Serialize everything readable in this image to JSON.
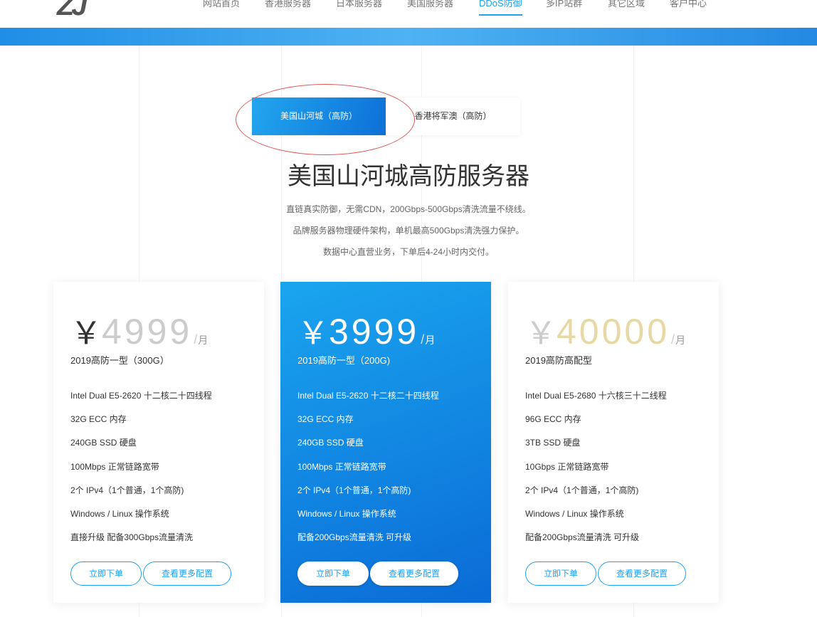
{
  "nav": {
    "logo": "ZJ",
    "items": [
      "网站首页",
      "香港服务器",
      "日本服务器",
      "美国服务器",
      "DDoS防御",
      "多IP站群",
      "其它区域",
      "客户中心"
    ],
    "active_index": 4
  },
  "tabs": [
    "美国山河城（高防）",
    "香港将军澳（高防）"
  ],
  "active_tab": 0,
  "heading": "美国山河城高防服务器",
  "description": [
    "直链真实防御，无需CDN，200Gbps-500Gbps清洗流量不绕线。",
    "品牌服务器物理硬件架构，单机最高500Gbps清洗强力保护。",
    "数据中心直营业务，下单后4-24小时内交付。"
  ],
  "plans": [
    {
      "currency": "￥",
      "price": "4999",
      "unit": "月",
      "name": "2019高防一型（300G）",
      "specs": [
        "Intel Dual E5-2620 十二核二十四线程",
        "32G ECC 内存",
        "240GB SSD 硬盘",
        "100Mbps 正常链路宽带",
        "2个 IPv4（1个普通，1个高防)",
        "Windows / Linux 操作系统",
        "直接升级 配备300Gbps流量清洗"
      ],
      "order_label": "立即下单",
      "more_label": "查看更多配置"
    },
    {
      "currency": "￥",
      "price": "3999",
      "unit": "月",
      "name": "2019高防一型（200G)",
      "specs": [
        "Intel Dual E5-2620 十二核二十四线程",
        "32G ECC 内存",
        "240GB SSD 硬盘",
        "100Mbps 正常链路宽带",
        "2个 IPv4（1个普通，1个高防)",
        "Windows / Linux 操作系统",
        "配备200Gbps流量清洗 可升级"
      ],
      "order_label": "立即下单",
      "more_label": "查看更多配置"
    },
    {
      "currency": "￥",
      "price": "40000",
      "unit": "月",
      "name": "2019高防高配型",
      "specs": [
        "Intel Dual E5-2680 十六核三十二线程",
        "96G ECC 内存",
        "3TB SSD 硬盘",
        "10Gbps 正常链路宽带",
        "2个 IPv4（1个普通，1个高防)",
        "Windows / Linux 操作系统",
        "配备200Gbps流量清洗 可升级"
      ],
      "order_label": "立即下单",
      "more_label": "查看更多配置"
    }
  ],
  "colors": {
    "accent": "#1ea2f0",
    "featured_gradient_start": "#1aa5ef",
    "featured_gradient_end": "#0a6bd6",
    "annotation_ellipse": "#e05a5a"
  }
}
